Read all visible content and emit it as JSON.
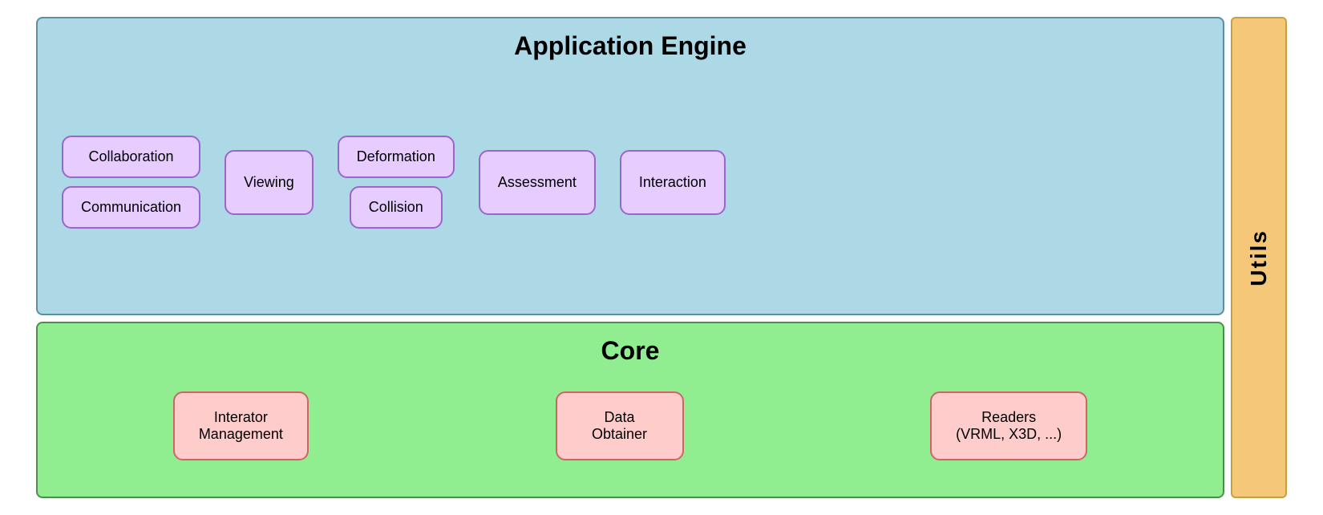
{
  "appEngine": {
    "title": "Application Engine",
    "modules": {
      "collaborationLabel": "Collaboration",
      "communicationLabel": "Communication",
      "viewingLabel": "Viewing",
      "deformationLabel": "Deformation",
      "collisionLabel": "Collision",
      "assessmentLabel": "Assessment",
      "interactionLabel": "Interaction"
    }
  },
  "core": {
    "title": "Core",
    "modules": {
      "interatorLabel": "Interator\nManagement",
      "dataLabel": "Data\nObtainer",
      "readersLabel": "Readers\n(VRML, X3D, ...)"
    }
  },
  "utils": {
    "label": "Utils"
  },
  "colors": {
    "appEngineBg": "#add8e6",
    "appEngineBorder": "#5b8fa8",
    "coreBg": "#90ee90",
    "coreBorder": "#4a8f4a",
    "utilsBg": "#f4c878",
    "utilsBorder": "#c8a040",
    "appModuleBg": "#e6ccff",
    "appModuleBorder": "#9966cc",
    "coreModuleBg": "#ffcccc",
    "coreModuleBorder": "#cc6666"
  }
}
